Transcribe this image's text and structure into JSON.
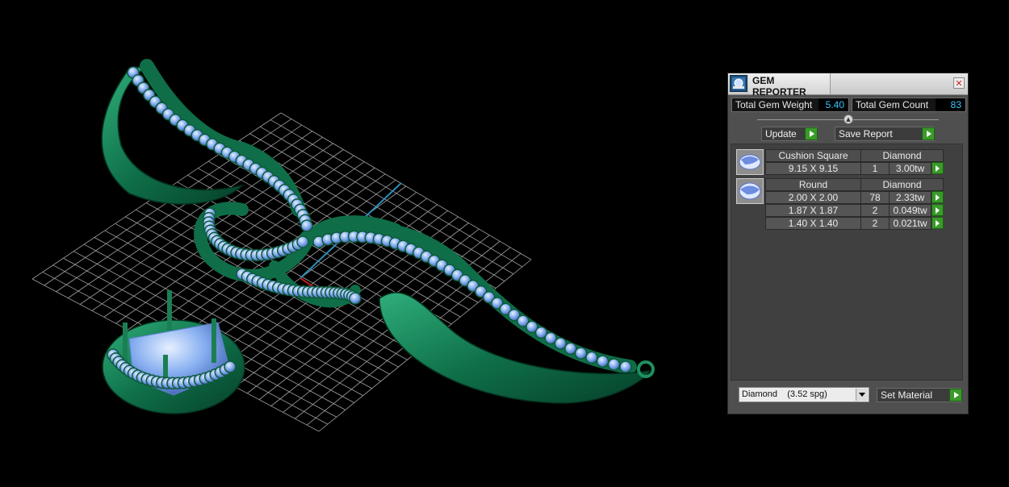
{
  "window": {
    "title": "GEM REPORTER"
  },
  "totals": {
    "weight_label": "Total Gem Weight",
    "weight_value": "5.40",
    "count_label": "Total Gem Count",
    "count_value": "83"
  },
  "actions": {
    "update_label": "Update",
    "save_label": "Save Report"
  },
  "groups": [
    {
      "shape": "Cushion Square",
      "material": "Diamond",
      "rows": [
        {
          "size": "9.15 X 9.15",
          "count": "1",
          "weight": "3.00tw"
        }
      ]
    },
    {
      "shape": "Round",
      "material": "Diamond",
      "rows": [
        {
          "size": "2.00 X 2.00",
          "count": "78",
          "weight": "2.33tw"
        },
        {
          "size": "1.87 X 1.87",
          "count": "2",
          "weight": "0.049tw"
        },
        {
          "size": "1.40 X 1.40",
          "count": "2",
          "weight": "0.021tw"
        }
      ]
    }
  ],
  "material": {
    "selected": "Diamond    (3.52 spg)",
    "set_label": "Set Material"
  },
  "colors": {
    "metal": "#0e6b45",
    "metal_light": "#2fa874",
    "gem": "#7ea9ec",
    "grid": "#bdbdbd",
    "panel_bg": "#4f4f4f",
    "value_text": "#39c6ff",
    "go_button": "#3a9a2a"
  },
  "icons": {
    "window": "gem-reporter-icon",
    "close": "close-icon",
    "collapse": "collapse-arrow-icon",
    "go": "play-arrow-icon",
    "gem_cushion": "cushion-gem-icon",
    "gem_round": "round-gem-icon"
  }
}
